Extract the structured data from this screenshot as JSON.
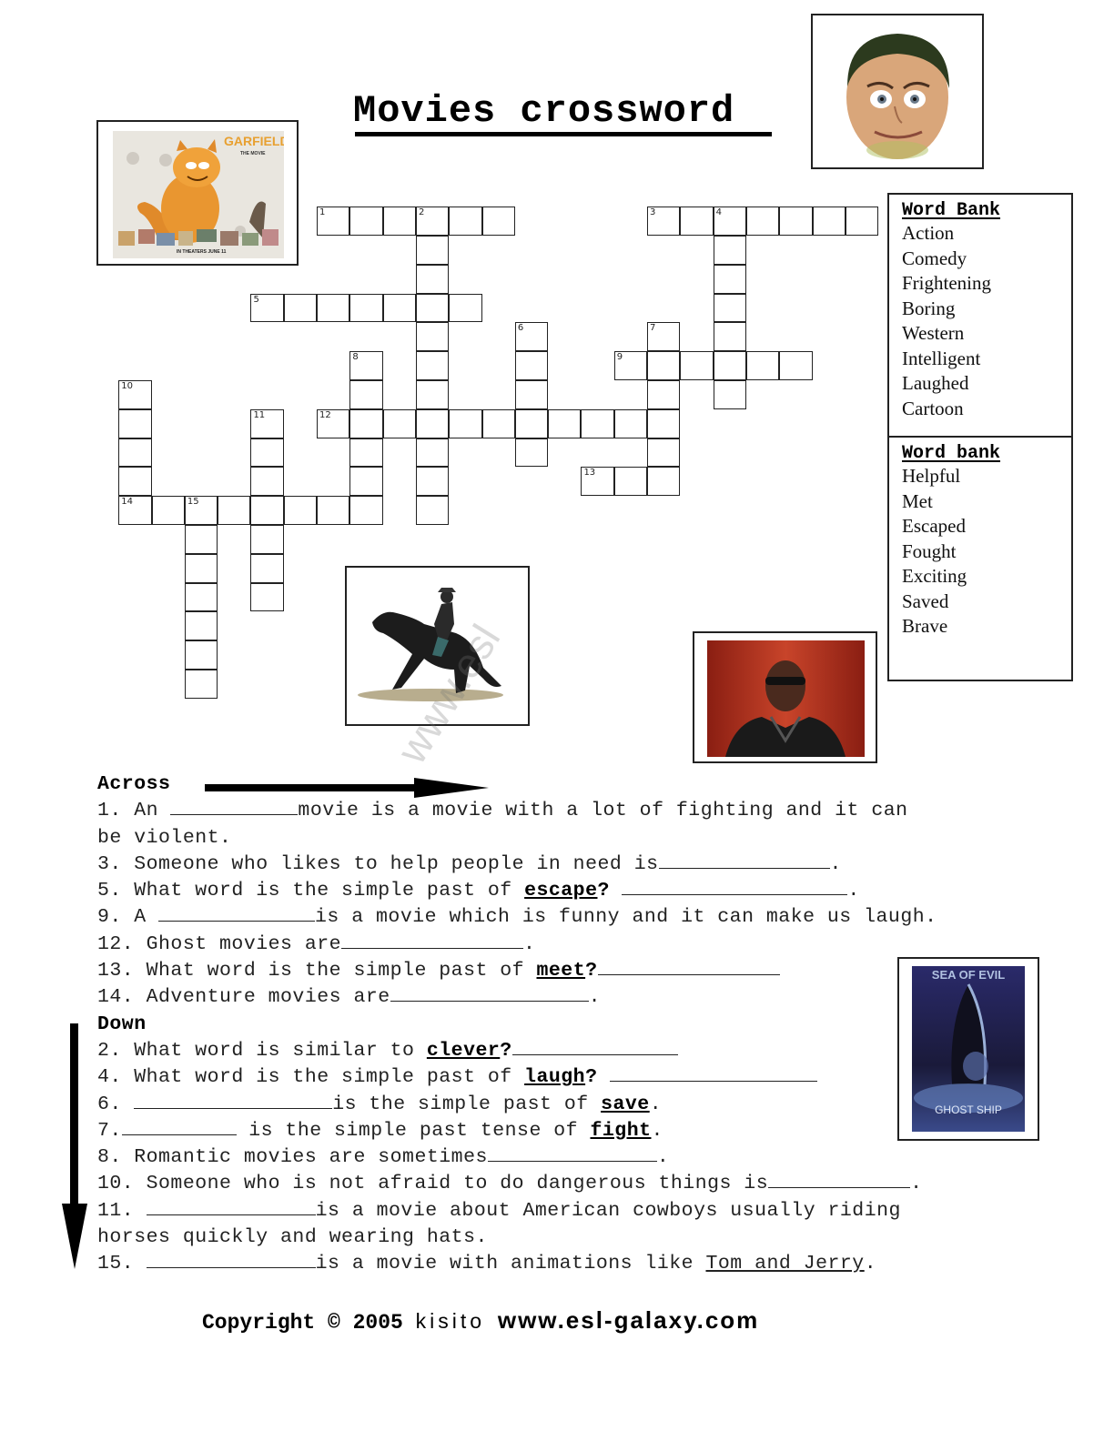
{
  "title": "Movies crossword",
  "images": {
    "garfield": {
      "alt": "Garfield the movie poster",
      "poster_title": "GARFIELD",
      "poster_subtitle": "THE MOVIE",
      "poster_tagline": "IN THEATERS JUNE 11"
    },
    "mr_bean": {
      "alt": "Mr Bean face"
    },
    "cowboy": {
      "alt": "Cowboy riding a horse"
    },
    "blade": {
      "alt": "Man in sunglasses and leather jacket"
    },
    "ghost_ship": {
      "alt": "Ghost Ship movie poster",
      "poster_top": "SEA OF EVIL",
      "poster_title": "GHOST SHIP"
    }
  },
  "grid": {
    "words": [
      {
        "num": 1,
        "dir": "across",
        "row": 0,
        "col": 6,
        "len": 6
      },
      {
        "num": 2,
        "dir": "down",
        "row": 0,
        "col": 9,
        "len": 11
      },
      {
        "num": 3,
        "dir": "across",
        "row": 0,
        "col": 16,
        "len": 7
      },
      {
        "num": 4,
        "dir": "down",
        "row": 0,
        "col": 18,
        "len": 7
      },
      {
        "num": 5,
        "dir": "across",
        "row": 3,
        "col": 4,
        "len": 7
      },
      {
        "num": 6,
        "dir": "down",
        "row": 4,
        "col": 12,
        "len": 5
      },
      {
        "num": 7,
        "dir": "down",
        "row": 4,
        "col": 16,
        "len": 6
      },
      {
        "num": 8,
        "dir": "down",
        "row": 5,
        "col": 7,
        "len": 6
      },
      {
        "num": 9,
        "dir": "across",
        "row": 5,
        "col": 15,
        "len": 6
      },
      {
        "num": 10,
        "dir": "down",
        "row": 6,
        "col": 0,
        "len": 5
      },
      {
        "num": 11,
        "dir": "down",
        "row": 7,
        "col": 4,
        "len": 7
      },
      {
        "num": 12,
        "dir": "across",
        "row": 7,
        "col": 6,
        "len": 11
      },
      {
        "num": 13,
        "dir": "across",
        "row": 9,
        "col": 14,
        "len": 3
      },
      {
        "num": 14,
        "dir": "across",
        "row": 10,
        "col": 0,
        "len": 8
      },
      {
        "num": 15,
        "dir": "down",
        "row": 10,
        "col": 2,
        "len": 7
      }
    ]
  },
  "word_bank_1": {
    "heading": "Word Bank",
    "words": [
      "Action",
      "Comedy",
      "Frightening",
      "Boring",
      "Western",
      "Intelligent",
      "Laughed",
      "Cartoon"
    ]
  },
  "word_bank_2": {
    "heading": "Word bank",
    "words": [
      "Helpful",
      "Met",
      "Escaped",
      "Fought",
      "Exciting",
      "Saved",
      "Brave"
    ]
  },
  "clues": {
    "across_heading": "Across",
    "down_heading": "Down",
    "across": {
      "c1_a": "1. An ",
      "c1_b": "movie is a movie with a lot of fighting and it can",
      "c1_c": "be violent.",
      "c3_a": "3. Someone who likes to help people in need is",
      "c3_b": ".",
      "c5_a": "5. What word is the simple past of ",
      "c5_key": "escape",
      "c5_b": "? ",
      "c5_c": ".",
      "c9_a": "9. A ",
      "c9_b": "is a movie which is funny and it can make us laugh.",
      "c12_a": "12. Ghost movies are",
      "c12_b": ".",
      "c13_a": "13. What word is the simple past of ",
      "c13_key": "meet",
      "c13_b": "?",
      "c14_a": "14. Adventure movies are",
      "c14_b": "."
    },
    "down": {
      "c2_a": "2. What word is similar to ",
      "c2_key": "clever",
      "c2_b": "?",
      "c4_a": "4. What word is the simple past of ",
      "c4_key": "laugh",
      "c4_b": "? ",
      "c6_a": "6. ",
      "c6_b": "is the simple past of ",
      "c6_key": "save",
      "c6_c": ".",
      "c7_a": "7.",
      "c7_b": " is the simple past tense of ",
      "c7_key": "fight",
      "c7_c": ".",
      "c8_a": "8. Romantic movies are sometimes",
      "c8_b": ".",
      "c10_a": "10. Someone who is not afraid to do dangerous things is",
      "c10_b": ".",
      "c11_a": "11. ",
      "c11_b": "is a movie about American cowboys usually riding",
      "c11_c": "horses quickly and wearing hats.",
      "c15_a": "15. ",
      "c15_b": "is a movie with animations like ",
      "c15_u": "Tom and Jerry",
      "c15_c": "."
    }
  },
  "watermark": "www.esl",
  "footer": {
    "copyright": "Copyright © 2005 ",
    "author": "kisito",
    "url": "www.esl-galaxy.com"
  }
}
